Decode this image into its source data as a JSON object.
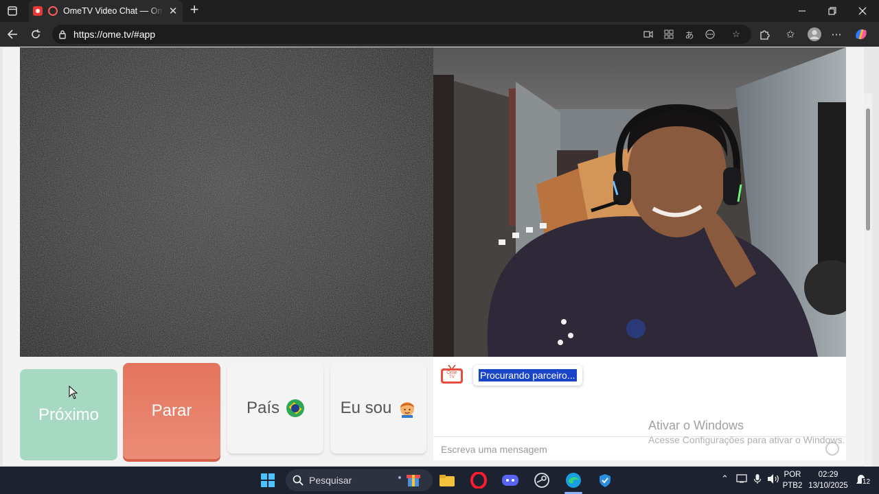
{
  "browser": {
    "tab_title": "OmeTV Video Chat — Omegle",
    "url": "https://ome.tv/#app"
  },
  "page": {
    "buttons": {
      "next": "Próximo",
      "stop": "Parar",
      "country": "País",
      "iam": "Eu sou"
    },
    "chat": {
      "logo_text_top": "Ome",
      "logo_text_bottom": "TV",
      "status_message": "Procurando parceiro...",
      "input_placeholder": "Escreva uma mensagem"
    },
    "watermark": {
      "line1": "Ativar o Windows",
      "line2": "Acesse Configurações para ativar o Windows."
    },
    "colors": {
      "next_button": "#a7d9c2",
      "stop_button": "#e4745e",
      "selection_highlight": "#1a44c8"
    }
  },
  "taskbar": {
    "search_label": "Pesquisar",
    "lang_line1": "POR",
    "lang_line2": "PTB2",
    "time": "02:29",
    "date": "13/10/2025",
    "notification_count": "12"
  }
}
